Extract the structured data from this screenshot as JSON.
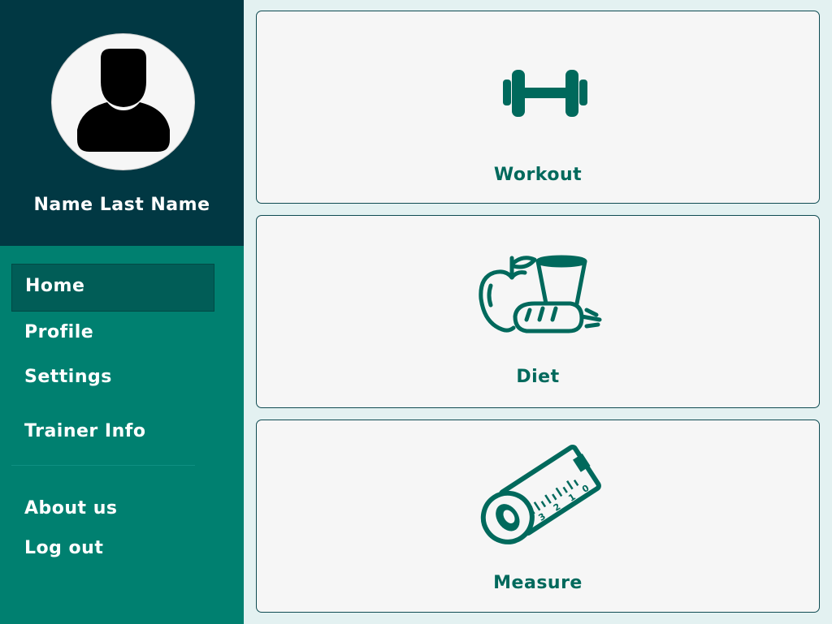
{
  "user": {
    "name": "Name Last Name",
    "avatar_icon": "user-silhouette-icon"
  },
  "nav": {
    "items": [
      {
        "label": "Home",
        "active": true
      },
      {
        "label": "Profile",
        "active": false
      },
      {
        "label": "Settings",
        "active": false
      },
      {
        "label": "Trainer Info",
        "active": false
      },
      {
        "label": "About us",
        "active": false
      },
      {
        "label": "Log out",
        "active": false
      }
    ]
  },
  "cards": [
    {
      "label": "Workout",
      "icon": "dumbbell-icon"
    },
    {
      "label": "Diet",
      "icon": "food-icon"
    },
    {
      "label": "Measure",
      "icon": "tape-measure-icon"
    }
  ],
  "colors": {
    "sidebar": "#008070",
    "header": "#013843",
    "active_nav": "#015d57",
    "accent": "#00695c",
    "card_bg": "#f6f6f6",
    "page_bg": "#e3f1f1"
  }
}
